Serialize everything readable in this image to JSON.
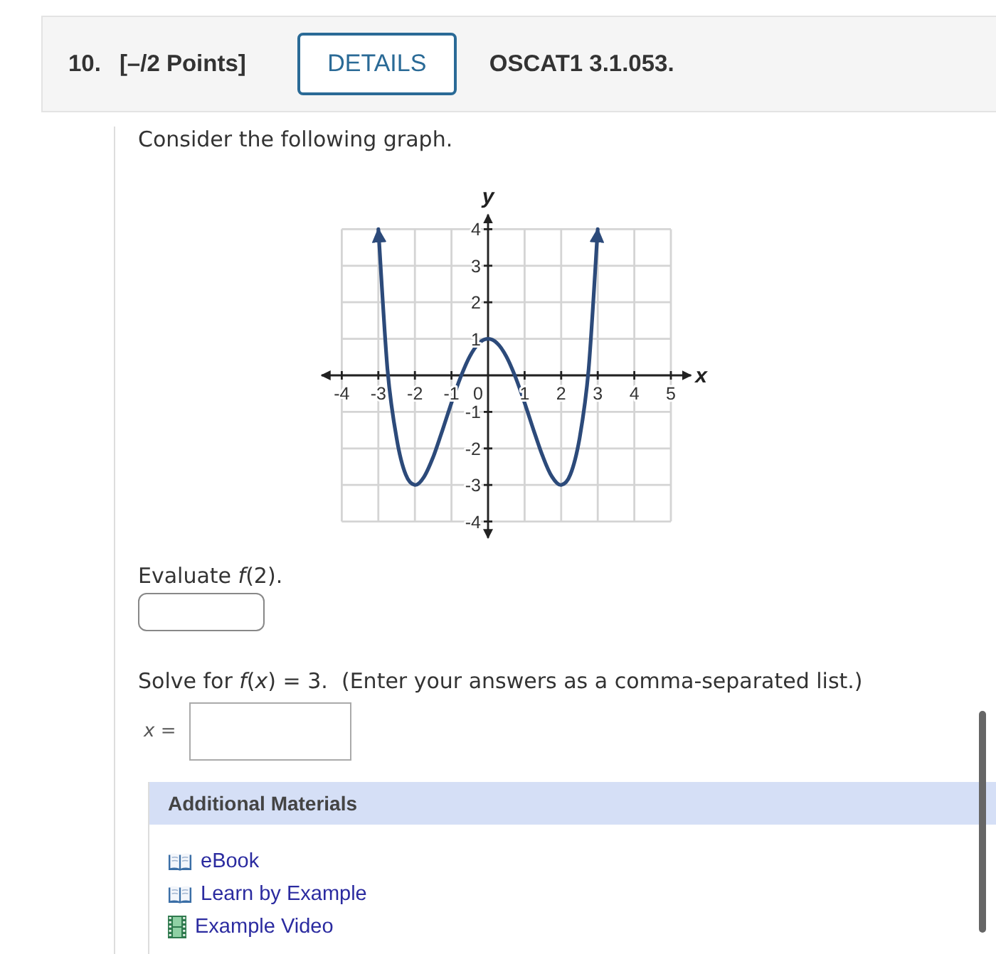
{
  "question": {
    "number": "10.",
    "points": "[–/2 Points]",
    "details_button": "DETAILS",
    "code": "OSCAT1 3.1.053."
  },
  "intro": "Consider the following graph.",
  "graph": {
    "chart_data": {
      "type": "line",
      "xlabel": "x",
      "ylabel": "y",
      "x": [
        -3,
        -2.75,
        -2.5,
        -2.25,
        -2,
        -1.75,
        -1.5,
        -1.25,
        -1,
        -0.75,
        -0.5,
        -0.25,
        0,
        0.25,
        0.5,
        0.75,
        1,
        1.25,
        1.5,
        1.75,
        2,
        2.25,
        2.5,
        2.75,
        3
      ],
      "series": [
        {
          "color": "#2c4a7a",
          "values": [
            4,
            0.17,
            -1.73,
            -2.72,
            -3,
            -2.78,
            -2.23,
            -1.51,
            -0.75,
            -0.05,
            0.52,
            0.88,
            1,
            0.88,
            0.52,
            -0.05,
            -0.75,
            -1.51,
            -2.23,
            -2.78,
            -3,
            -2.72,
            -1.73,
            0.17,
            4
          ]
        }
      ],
      "xlim": [
        -4,
        5
      ],
      "ylim": [
        -4,
        4
      ],
      "xticks": [
        -4,
        -3,
        -2,
        -1,
        0,
        1,
        2,
        3,
        4,
        5
      ],
      "yticks": [
        -4,
        -3,
        -2,
        -1,
        1,
        2,
        3,
        4
      ],
      "grid": true
    }
  },
  "parts": [
    {
      "kind": "compact",
      "prompt": "Evaluate *f*(2)."
    },
    {
      "kind": "labeled",
      "prompt": "Solve for *f*(*x*) = 3.  (Enter your answers as a comma-separated list.)",
      "field_label": "*x* ="
    }
  ],
  "additional_materials": {
    "title": "Additional Materials",
    "links": [
      {
        "kind": "book",
        "label": "eBook"
      },
      {
        "kind": "book",
        "label": "Learn by Example"
      },
      {
        "kind": "video",
        "label": "Example Video"
      }
    ]
  }
}
